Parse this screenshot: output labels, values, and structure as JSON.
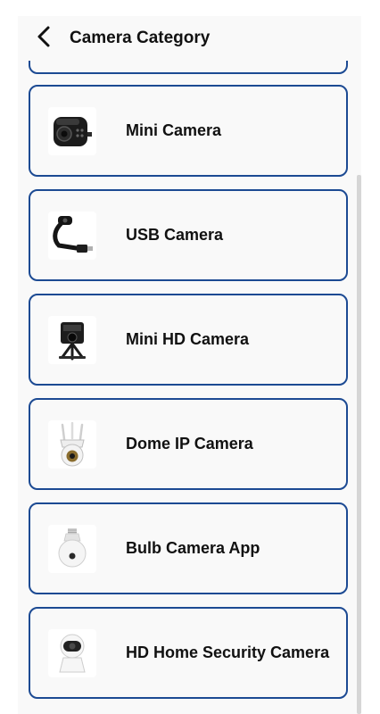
{
  "header": {
    "title": "Camera Category",
    "back_icon": "chevron-left-icon"
  },
  "categories": [
    {
      "label": "Mini Camera",
      "icon": "mini-camera-icon"
    },
    {
      "label": "USB Camera",
      "icon": "usb-camera-icon"
    },
    {
      "label": "Mini HD Camera",
      "icon": "mini-hd-camera-icon"
    },
    {
      "label": "Dome IP Camera",
      "icon": "dome-camera-icon"
    },
    {
      "label": "Bulb Camera App",
      "icon": "bulb-camera-icon"
    },
    {
      "label": "HD Home Security Camera",
      "icon": "security-camera-icon"
    }
  ],
  "colors": {
    "border": "#1c4a93",
    "background": "#f9f9f9",
    "text": "#111111"
  }
}
